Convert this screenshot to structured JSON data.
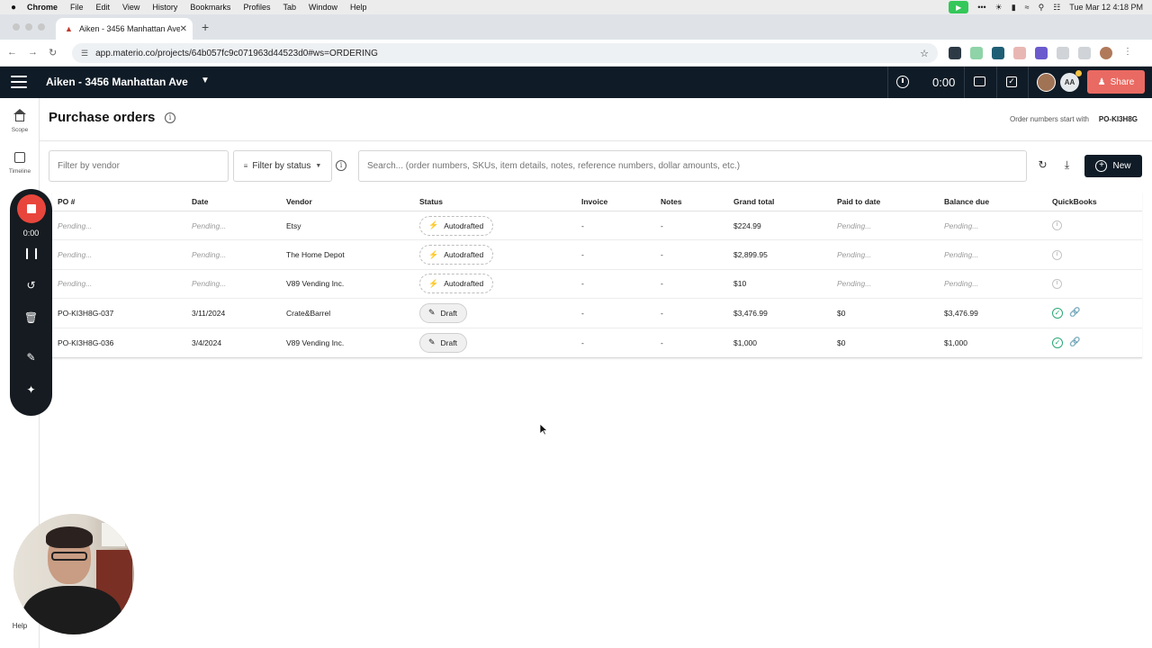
{
  "macos": {
    "apple": "",
    "menus": [
      "Chrome",
      "File",
      "Edit",
      "View",
      "History",
      "Bookmarks",
      "Profiles",
      "Tab",
      "Window",
      "Help"
    ],
    "datetime": "Tue Mar 12  4:18 PM"
  },
  "browser": {
    "tab_title": "Aiken - 3456 Manhattan Ave",
    "url": "app.materio.co/projects/64b057fc9c071963d44523d0#ws=ORDERING"
  },
  "app": {
    "project_name": "Aiken - 3456 Manhattan Ave",
    "timer": "0:00",
    "user_initials": "AA",
    "share_label": "Share"
  },
  "rail": {
    "scope_label": "Scope",
    "timeline_label": "Timeline",
    "help_label": "Help"
  },
  "recorder": {
    "time": "0:00"
  },
  "page": {
    "title": "Purchase orders",
    "order_prefix_label": "Order numbers start with",
    "order_prefix": "PO-KI3H8G"
  },
  "filters": {
    "vendor_placeholder": "Filter by vendor",
    "status_label": "Filter by status",
    "search_placeholder": "Search... (order numbers, SKUs, item details, notes, reference numbers, dollar amounts, etc.)",
    "new_label": "New"
  },
  "table": {
    "columns": {
      "po": "PO #",
      "date": "Date",
      "vendor": "Vendor",
      "status": "Status",
      "invoice": "Invoice",
      "notes": "Notes",
      "total": "Grand total",
      "paid": "Paid to date",
      "balance": "Balance due",
      "qb": "QuickBooks"
    },
    "rows": [
      {
        "po": "Pending...",
        "date": "Pending...",
        "vendor": "Etsy",
        "status": "Autodrafted",
        "invoice": "-",
        "notes": "-",
        "total": "$224.99",
        "paid": "Pending...",
        "balance": "Pending...",
        "qb": "pending"
      },
      {
        "po": "Pending...",
        "date": "Pending...",
        "vendor": "The Home Depot",
        "status": "Autodrafted",
        "invoice": "-",
        "notes": "-",
        "total": "$2,899.95",
        "paid": "Pending...",
        "balance": "Pending...",
        "qb": "pending"
      },
      {
        "po": "Pending...",
        "date": "Pending...",
        "vendor": "V89 Vending Inc.",
        "status": "Autodrafted",
        "invoice": "-",
        "notes": "-",
        "total": "$10",
        "paid": "Pending...",
        "balance": "Pending...",
        "qb": "pending"
      },
      {
        "po": "PO-KI3H8G-037",
        "date": "3/11/2024",
        "vendor": "Crate&Barrel",
        "status": "Draft",
        "invoice": "-",
        "notes": "-",
        "total": "$3,476.99",
        "paid": "$0",
        "balance": "$3,476.99",
        "qb": "synced"
      },
      {
        "po": "PO-KI3H8G-036",
        "date": "3/4/2024",
        "vendor": "V89 Vending Inc.",
        "status": "Draft",
        "invoice": "-",
        "notes": "-",
        "total": "$1,000",
        "paid": "$0",
        "balance": "$1,000",
        "qb": "synced"
      }
    ]
  },
  "colors": {
    "header_bg": "#0f1b26",
    "share_bg": "#e96a62",
    "record_red": "#e8463c",
    "synced_green": "#2aa876"
  }
}
